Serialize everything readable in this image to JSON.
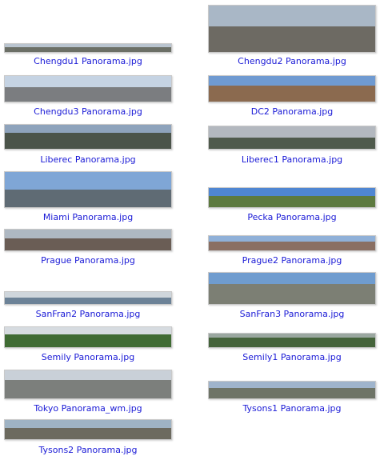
{
  "files": [
    {
      "name": "Chengdu1 Panorama.jpg",
      "sky": "#b9c4cf",
      "land": "#6b6f66"
    },
    {
      "name": "Chengdu2 Panorama.jpg",
      "sky": "#a9b7c6",
      "land": "#6d6a63"
    },
    {
      "name": "Chengdu3 Panorama.jpg",
      "sky": "#c5d3e3",
      "land": "#7b7d80"
    },
    {
      "name": "DC2 Panorama.jpg",
      "sky": "#6f9ad1",
      "land": "#8b6a4f"
    },
    {
      "name": "Liberec Panorama.jpg",
      "sky": "#8ea3bc",
      "land": "#4b544a"
    },
    {
      "name": "Liberec1 Panorama.jpg",
      "sky": "#b3b8bf",
      "land": "#4f5a4c"
    },
    {
      "name": "Miami Panorama.jpg",
      "sky": "#7fa6d6",
      "land": "#5f6b74"
    },
    {
      "name": "Pecka Panorama.jpg",
      "sky": "#4f86d2",
      "land": "#5d7a3f"
    },
    {
      "name": "Prague Panorama.jpg",
      "sky": "#aeb8c2",
      "land": "#6a5d55"
    },
    {
      "name": "Prague2 Panorama.jpg",
      "sky": "#8fb0d8",
      "land": "#8a6f63"
    },
    {
      "name": "SanFran2 Panorama.jpg",
      "sky": "#cfd6dc",
      "land": "#6c8297"
    },
    {
      "name": "SanFran3 Panorama.jpg",
      "sky": "#6f9ccf",
      "land": "#7c7f74"
    },
    {
      "name": "Semily Panorama.jpg",
      "sky": "#d6dbe0",
      "land": "#3f6b33"
    },
    {
      "name": "Semily1 Panorama.jpg",
      "sky": "#9aa7a0",
      "land": "#44633a"
    },
    {
      "name": "Tokyo Panorama_wm.jpg",
      "sky": "#c9d0d8",
      "land": "#7c7f7c"
    },
    {
      "name": "Tysons1 Panorama.jpg",
      "sky": "#9fb4cc",
      "land": "#6e7467"
    },
    {
      "name": "Tysons2 Panorama.jpg",
      "sky": "#9fb3c4",
      "land": "#6c6a5f"
    }
  ]
}
